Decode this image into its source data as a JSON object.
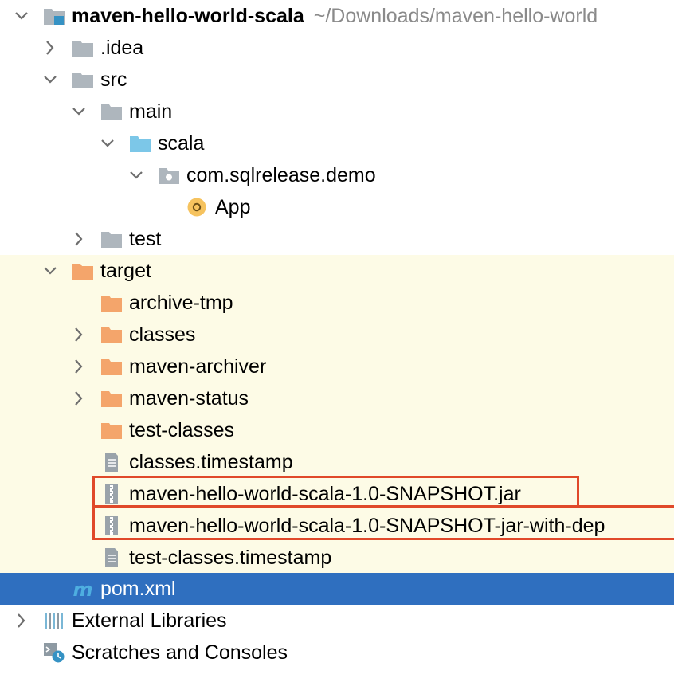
{
  "tree": {
    "root": {
      "label": "maven-hello-world-scala",
      "path": "~/Downloads/maven-hello-world"
    },
    "nodes": [
      {
        "label": ".idea"
      },
      {
        "label": "src"
      },
      {
        "label": "main"
      },
      {
        "label": "scala"
      },
      {
        "label": "com.sqlrelease.demo"
      },
      {
        "label": "App"
      },
      {
        "label": "test"
      },
      {
        "label": "target"
      },
      {
        "label": "archive-tmp"
      },
      {
        "label": "classes"
      },
      {
        "label": "maven-archiver"
      },
      {
        "label": "maven-status"
      },
      {
        "label": "test-classes"
      },
      {
        "label": "classes.timestamp"
      },
      {
        "label": "maven-hello-world-scala-1.0-SNAPSHOT.jar"
      },
      {
        "label": "maven-hello-world-scala-1.0-SNAPSHOT-jar-with-dep"
      },
      {
        "label": "test-classes.timestamp"
      },
      {
        "label": "pom.xml"
      },
      {
        "label": "External Libraries"
      },
      {
        "label": "Scratches and Consoles"
      }
    ]
  },
  "colors": {
    "folder_gray": "#aeb6bd",
    "folder_blue": "#7cc7e8",
    "folder_orange": "#f4a56b",
    "selection": "#2f6fbf",
    "excluded_bg": "#fdfbe6",
    "highlight_border": "#e0492a"
  }
}
